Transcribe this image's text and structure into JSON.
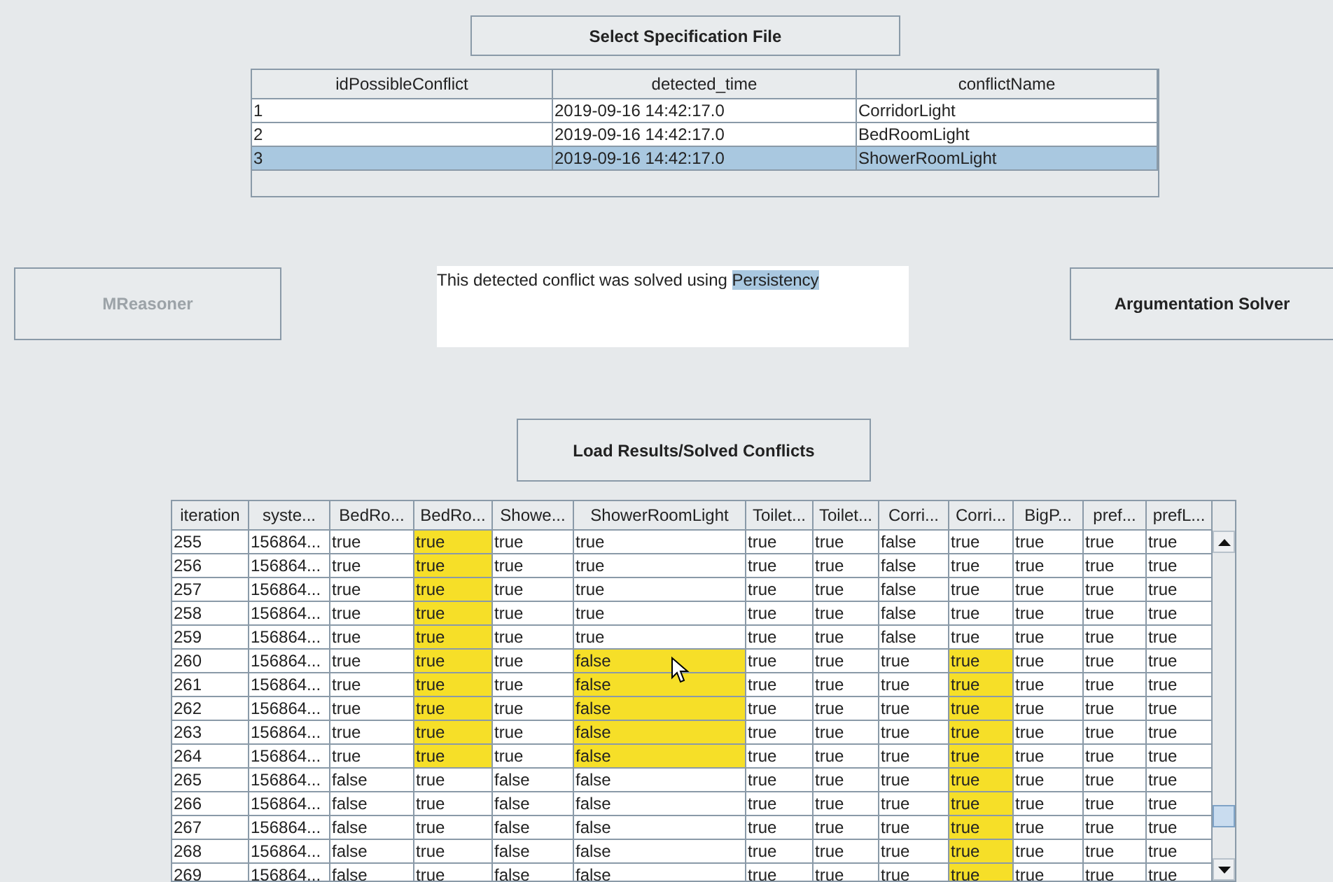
{
  "select_button": {
    "label": "Select Specification File"
  },
  "conflicts_table": {
    "columns": [
      "idPossibleConflict",
      "detected_time",
      "conflictName"
    ],
    "rows": [
      {
        "cells": [
          "1",
          "2019-09-16 14:42:17.0",
          "CorridorLight"
        ],
        "selected": false
      },
      {
        "cells": [
          "2",
          "2019-09-16 14:42:17.0",
          "BedRoomLight"
        ],
        "selected": false
      },
      {
        "cells": [
          "3",
          "2019-09-16 14:42:17.0",
          "ShowerRoomLight"
        ],
        "selected": true
      }
    ]
  },
  "mreasoner_button": {
    "label": "MReasoner",
    "disabled": true
  },
  "message": {
    "text": "This detected conflict was solved using",
    "highlighted": "Persistency"
  },
  "argumentation_button": {
    "label": "Argumentation Solver",
    "disabled": false
  },
  "load_button": {
    "label": "Load Results/Solved Conflicts"
  },
  "results_table": {
    "columns": [
      "iteration",
      "syste...",
      "BedRo...",
      "BedRo...",
      "Showe...",
      "ShowerRoomLight",
      "Toilet...",
      "Toilet...",
      "Corri...",
      "Corri...",
      "BigP...",
      "pref...",
      "prefL..."
    ],
    "rows": [
      {
        "cells": [
          "255",
          "156864...",
          "true",
          "true",
          "true",
          "true",
          "true",
          "true",
          "false",
          "true",
          "true",
          "true",
          "true"
        ],
        "highlighted": [
          false,
          false,
          false,
          true,
          false,
          false,
          false,
          false,
          false,
          false,
          false,
          false,
          false
        ]
      },
      {
        "cells": [
          "256",
          "156864...",
          "true",
          "true",
          "true",
          "true",
          "true",
          "true",
          "false",
          "true",
          "true",
          "true",
          "true"
        ],
        "highlighted": [
          false,
          false,
          false,
          true,
          false,
          false,
          false,
          false,
          false,
          false,
          false,
          false,
          false
        ]
      },
      {
        "cells": [
          "257",
          "156864...",
          "true",
          "true",
          "true",
          "true",
          "true",
          "true",
          "false",
          "true",
          "true",
          "true",
          "true"
        ],
        "highlighted": [
          false,
          false,
          false,
          true,
          false,
          false,
          false,
          false,
          false,
          false,
          false,
          false,
          false
        ]
      },
      {
        "cells": [
          "258",
          "156864...",
          "true",
          "true",
          "true",
          "true",
          "true",
          "true",
          "false",
          "true",
          "true",
          "true",
          "true"
        ],
        "highlighted": [
          false,
          false,
          false,
          true,
          false,
          false,
          false,
          false,
          false,
          false,
          false,
          false,
          false
        ]
      },
      {
        "cells": [
          "259",
          "156864...",
          "true",
          "true",
          "true",
          "true",
          "true",
          "true",
          "false",
          "true",
          "true",
          "true",
          "true"
        ],
        "highlighted": [
          false,
          false,
          false,
          true,
          false,
          false,
          false,
          false,
          false,
          false,
          false,
          false,
          false
        ]
      },
      {
        "cells": [
          "260",
          "156864...",
          "true",
          "true",
          "true",
          "false",
          "true",
          "true",
          "true",
          "true",
          "true",
          "true",
          "true"
        ],
        "highlighted": [
          false,
          false,
          false,
          true,
          false,
          true,
          false,
          false,
          false,
          true,
          false,
          false,
          false
        ]
      },
      {
        "cells": [
          "261",
          "156864...",
          "true",
          "true",
          "true",
          "false",
          "true",
          "true",
          "true",
          "true",
          "true",
          "true",
          "true"
        ],
        "highlighted": [
          false,
          false,
          false,
          true,
          false,
          true,
          false,
          false,
          false,
          true,
          false,
          false,
          false
        ]
      },
      {
        "cells": [
          "262",
          "156864...",
          "true",
          "true",
          "true",
          "false",
          "true",
          "true",
          "true",
          "true",
          "true",
          "true",
          "true"
        ],
        "highlighted": [
          false,
          false,
          false,
          true,
          false,
          true,
          false,
          false,
          false,
          true,
          false,
          false,
          false
        ]
      },
      {
        "cells": [
          "263",
          "156864...",
          "true",
          "true",
          "true",
          "false",
          "true",
          "true",
          "true",
          "true",
          "true",
          "true",
          "true"
        ],
        "highlighted": [
          false,
          false,
          false,
          true,
          false,
          true,
          false,
          false,
          false,
          true,
          false,
          false,
          false
        ]
      },
      {
        "cells": [
          "264",
          "156864...",
          "true",
          "true",
          "true",
          "false",
          "true",
          "true",
          "true",
          "true",
          "true",
          "true",
          "true"
        ],
        "highlighted": [
          false,
          false,
          false,
          true,
          false,
          true,
          false,
          false,
          false,
          true,
          false,
          false,
          false
        ]
      },
      {
        "cells": [
          "265",
          "156864...",
          "false",
          "true",
          "false",
          "false",
          "true",
          "true",
          "true",
          "true",
          "true",
          "true",
          "true"
        ],
        "highlighted": [
          false,
          false,
          false,
          false,
          false,
          false,
          false,
          false,
          false,
          true,
          false,
          false,
          false
        ]
      },
      {
        "cells": [
          "266",
          "156864...",
          "false",
          "true",
          "false",
          "false",
          "true",
          "true",
          "true",
          "true",
          "true",
          "true",
          "true"
        ],
        "highlighted": [
          false,
          false,
          false,
          false,
          false,
          false,
          false,
          false,
          false,
          true,
          false,
          false,
          false
        ]
      },
      {
        "cells": [
          "267",
          "156864...",
          "false",
          "true",
          "false",
          "false",
          "true",
          "true",
          "true",
          "true",
          "true",
          "true",
          "true"
        ],
        "highlighted": [
          false,
          false,
          false,
          false,
          false,
          false,
          false,
          false,
          false,
          true,
          false,
          false,
          false
        ]
      },
      {
        "cells": [
          "268",
          "156864...",
          "false",
          "true",
          "false",
          "false",
          "true",
          "true",
          "true",
          "true",
          "true",
          "true",
          "true"
        ],
        "highlighted": [
          false,
          false,
          false,
          false,
          false,
          false,
          false,
          false,
          false,
          true,
          false,
          false,
          false
        ]
      },
      {
        "cells": [
          "269",
          "156864...",
          "false",
          "true",
          "false",
          "false",
          "true",
          "true",
          "true",
          "true",
          "true",
          "true",
          "true"
        ],
        "highlighted": [
          false,
          false,
          false,
          false,
          false,
          false,
          false,
          false,
          false,
          true,
          false,
          false,
          false
        ]
      }
    ]
  }
}
